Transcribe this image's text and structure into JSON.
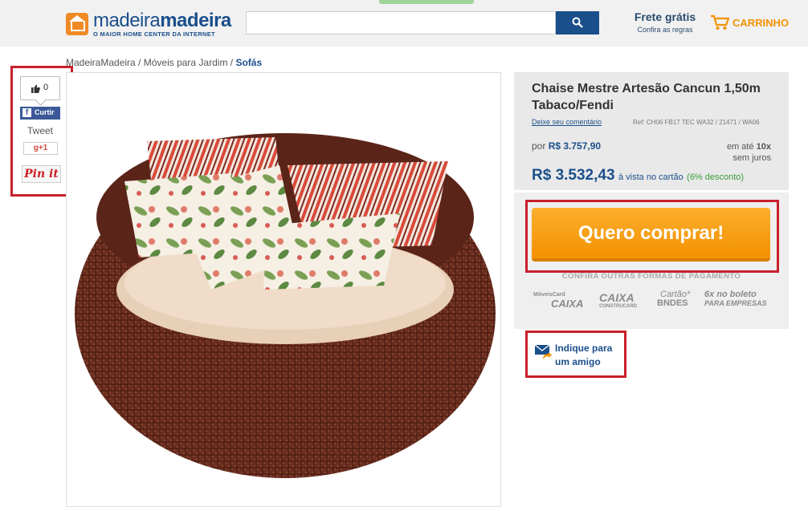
{
  "header": {
    "logo_bold": "madeira",
    "logo_thin": "madeira",
    "logo_tagline": "O MAIOR HOME CENTER DA INTERNET",
    "search_placeholder": "",
    "frete_title": "Frete grátis",
    "frete_sub": "Confira as regras",
    "cart_label": "CARRINHO"
  },
  "breadcrumb": {
    "items": [
      "MadeiraMadeira",
      "Móveis para Jardim"
    ],
    "separator": " / ",
    "current": "Sofás"
  },
  "social": {
    "like_count": "0",
    "fb_label": "Curtir",
    "tweet_label": "Tweet",
    "gplus_label": "g+1",
    "pin_label": "Pin it"
  },
  "product": {
    "title": "Chaise Mestre Artesão Cancun 1,50m Tabaco/Fendi",
    "comment_link": "Deixe seu comentário",
    "ref": "Ref: CH06 FB17 TEC WA32 / 21471 / WA06",
    "old_price_prefix": "por",
    "old_price": "R$ 3.757,90",
    "installments_prefix": "em até",
    "installments_count": "10x",
    "installments_suffix": "sem juros",
    "price": "R$ 3.532,43",
    "price_sub": "à vista no cartão",
    "discount": "(6% desconto)"
  },
  "buy": {
    "button_label": "Quero comprar!",
    "other_payments": "CONFIRA OUTRAS FORMAS DE PAGAMENTO",
    "logos": [
      {
        "small": "MóveisCard",
        "big": "CAIXA"
      },
      {
        "small": "",
        "big": "CAIXA",
        "sub": "CONSTRUCARD"
      },
      {
        "small": "Cartão*",
        "big": "BNDES"
      },
      {
        "small": "6x no boleto",
        "big": "PARA EMPRESAS"
      }
    ]
  },
  "indicate": {
    "line1": "Indique para",
    "line2": "um amigo"
  },
  "colors": {
    "brand_blue": "#1a4f8b",
    "orange": "#f39200",
    "highlight_red": "#c9202c"
  }
}
